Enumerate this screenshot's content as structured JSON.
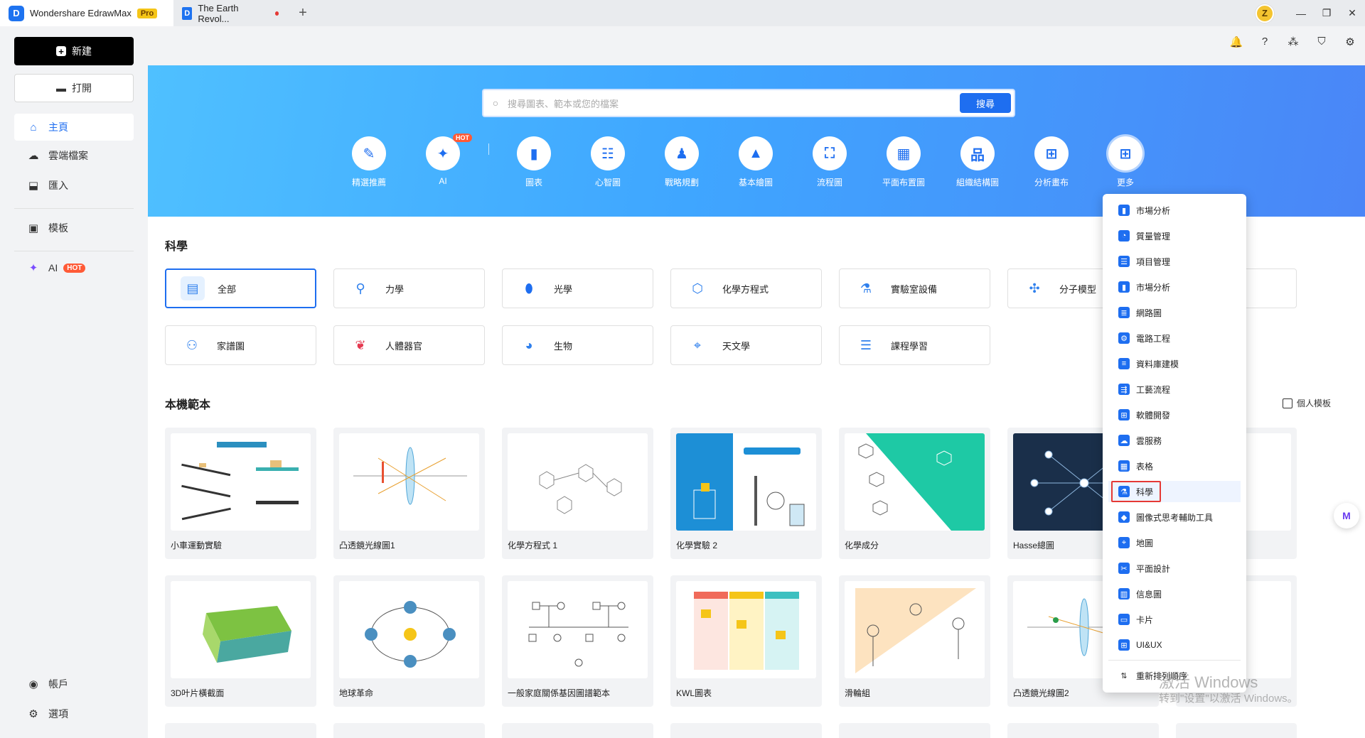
{
  "titlebar": {
    "app_tab": "Wondershare EdrawMax",
    "pro_label": "Pro",
    "doc_tab": "The Earth Revol...",
    "add_tab": "+",
    "avatar_letter": "Z",
    "win_min": "—",
    "win_restore": "❐",
    "win_close": "✕"
  },
  "top_icons": [
    "bell-icon",
    "help-icon",
    "apps-icon",
    "shirt-icon",
    "gear-icon"
  ],
  "sidebar": {
    "new_label": "新建",
    "open_label": "打開",
    "items": [
      {
        "label": "主頁",
        "icon": "home-icon"
      },
      {
        "label": "雲端檔案",
        "icon": "cloud-icon"
      },
      {
        "label": "匯入",
        "icon": "import-icon"
      },
      {
        "label": "模板",
        "icon": "template-icon"
      },
      {
        "label": "AI",
        "icon": "ai-icon",
        "badge": "HOT"
      },
      {
        "label": "帳戶",
        "icon": "account-icon"
      },
      {
        "label": "選項",
        "icon": "settings-icon"
      }
    ]
  },
  "search": {
    "placeholder": "搜尋圖表、範本或您的檔案",
    "button": "搜尋"
  },
  "categories": [
    {
      "label": "精選推薦"
    },
    {
      "label": "AI",
      "badge": "HOT"
    },
    {
      "label": "圖表"
    },
    {
      "label": "心智圖"
    },
    {
      "label": "戰略規劃"
    },
    {
      "label": "基本繪圖"
    },
    {
      "label": "流程圖"
    },
    {
      "label": "平面布置圖"
    },
    {
      "label": "組織結構圖"
    },
    {
      "label": "分析畫布"
    },
    {
      "label": "更多"
    }
  ],
  "science": {
    "title": "科學",
    "items": [
      "全部",
      "力學",
      "光學",
      "化學方程式",
      "實驗室設備",
      "分子模型",
      "家譜圖",
      "人體器官",
      "生物",
      "天文學",
      "課程學習"
    ]
  },
  "templates": {
    "title": "本機範本",
    "personal_label": "個人模板",
    "row1": [
      "小車運動實驗",
      "凸透鏡光線圖1",
      "化學方程式 1",
      "化學實驗 2",
      "化學成分",
      "Hasse總圖"
    ],
    "row2": [
      "3D叶片橫截面",
      "地球革命",
      "一般家庭關係基因圖譜範本",
      "KWL圖表",
      "滑輪組",
      "凸透鏡光線圖2"
    ]
  },
  "dropdown": {
    "items": [
      "市場分析",
      "質量管理",
      "項目管理",
      "市場分析",
      "網路圖",
      "電路工程",
      "資料庫建模",
      "工藝流程",
      "軟體開發",
      "雲服務",
      "表格",
      "科學",
      "圖像式思考輔助工具",
      "地圖",
      "平面設計",
      "信息圖",
      "卡片",
      "UI&UX"
    ],
    "highlighted": "科學",
    "reorder": "重新排列順序"
  },
  "watermark": {
    "line1": "激活 Windows",
    "line2": "转到\"设置\"以激活 Windows。"
  },
  "float_btn": "M"
}
